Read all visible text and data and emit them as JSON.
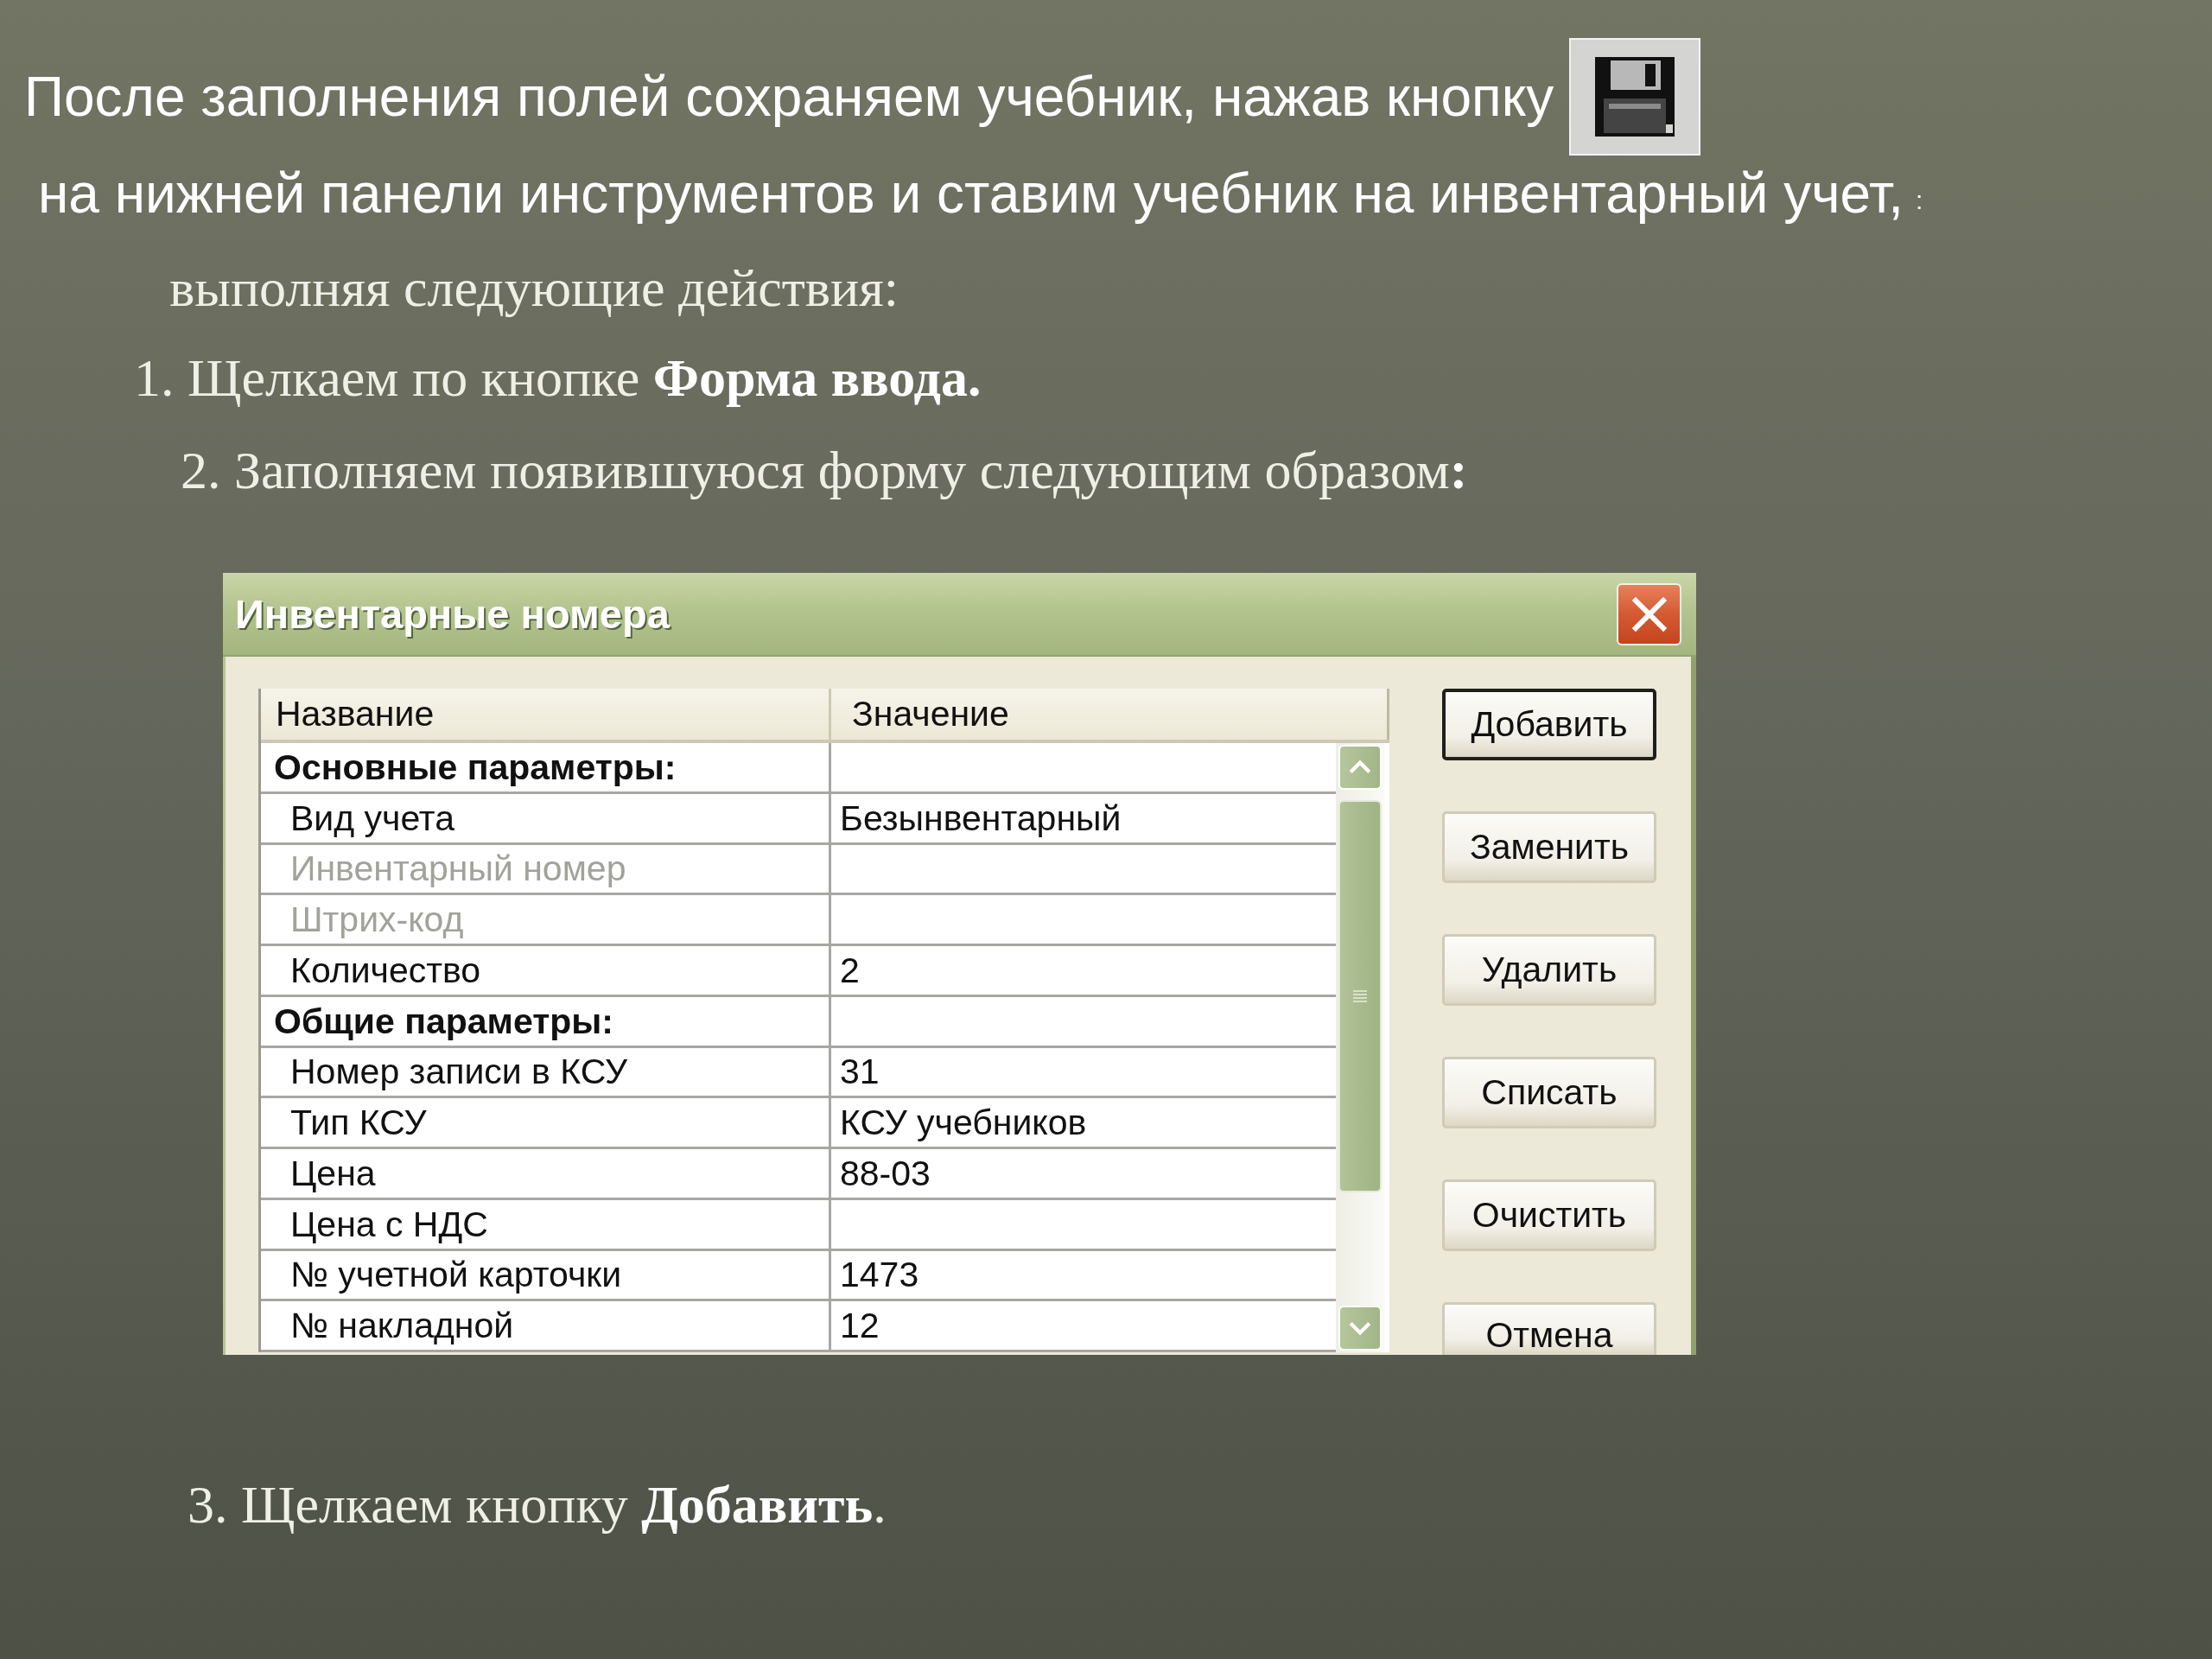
{
  "intro": {
    "line_1": "После заполнения полей сохраняем учебник, нажав кнопку",
    "line_2": "на нижней панели инструментов и ставим учебник на инвентарный учет,",
    "line_2_mark": ":",
    "line_3": "выполняя следующие действия:"
  },
  "steps": [
    "1. Щелкаем по кнопке **Форма ввода.**",
    "2. Заполняем появившуюся форму следующим образом**:**"
  ],
  "dialog": {
    "title": "Инвентарные номера",
    "columns": [
      "Название",
      "Значение"
    ],
    "rows": [
      {
        "kind": "section",
        "name": "Основные параметры:",
        "disabled": false
      },
      {
        "kind": "field",
        "name": "Вид учета",
        "value": "Безынвентарный",
        "disabled": false
      },
      {
        "kind": "field",
        "name": "Инвентарный номер",
        "disabled": true
      },
      {
        "kind": "field",
        "name": "Штрих-код",
        "disabled": true
      },
      {
        "kind": "field",
        "name": "Количество",
        "value": "2",
        "disabled": false
      },
      {
        "kind": "section",
        "name": "Общие параметры:",
        "disabled": false
      },
      {
        "kind": "field",
        "name": "Номер записи в КСУ",
        "value": "31",
        "disabled": false
      },
      {
        "kind": "field",
        "name": "Тип КСУ",
        "value": "КСУ учебников",
        "disabled": false
      },
      {
        "kind": "field",
        "name": "Цена",
        "value": "88-03",
        "disabled": false
      },
      {
        "kind": "field",
        "name": "Цена с НДС",
        "disabled": false
      },
      {
        "kind": "field",
        "name": "№ учетной карточки",
        "value": "1473",
        "disabled": false
      },
      {
        "kind": "field",
        "name": "№ накладной",
        "value": "12",
        "disabled": false
      }
    ],
    "buttons": [
      {
        "label": "Добавить",
        "default": true
      },
      {
        "label": "Заменить",
        "default": false
      },
      {
        "label": "Удалить",
        "default": false
      },
      {
        "label": "Списать",
        "default": false
      },
      {
        "label": "Очистить",
        "default": false
      },
      {
        "label": "Отмена",
        "default": false
      }
    ]
  },
  "final_step": "3. Щелкаем кнопку **Добавить**."
}
